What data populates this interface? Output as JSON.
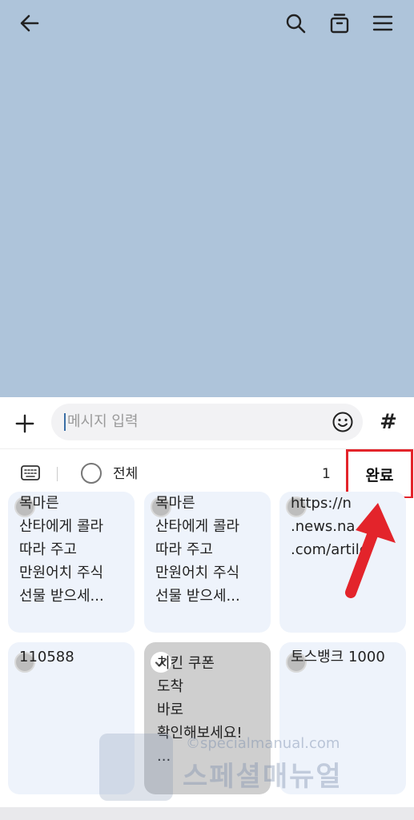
{
  "input": {
    "placeholder": "메시지 입력"
  },
  "toolbar": {
    "hash_label": "#"
  },
  "select_bar": {
    "all_label": "전체",
    "count": "1",
    "done_label": "완료"
  },
  "cards": [
    {
      "text": "목마른\n산타에게 콜라\n따라 주고\n만원어치 주식\n선물 받으세...",
      "selected": false
    },
    {
      "text": "목마른\n산타에게 콜라\n따라 주고\n만원어치 주식\n선물 받으세...",
      "selected": false
    },
    {
      "text": "https://n\n.news.na\n.com/artile",
      "selected": false
    },
    {
      "text": "110588",
      "selected": false
    },
    {
      "text": " 치킨 쿠폰\n도착\n바로\n확인해보세요!\n...",
      "selected": true
    },
    {
      "text": "토스뱅크 1000",
      "selected": false
    }
  ],
  "watermark": {
    "url": "©specialmanual.com",
    "brand": "스페셜매뉴얼"
  },
  "icons": [
    "back-arrow-icon",
    "search-icon",
    "drawer-icon",
    "menu-icon",
    "plus-icon",
    "emoji-icon",
    "keyboard-icon"
  ],
  "colors": {
    "chat_background": "#aec4da",
    "highlight_box": "#e3242b",
    "card_bg": "#eef3fb",
    "selected_card_bg": "#cfcfcf"
  }
}
